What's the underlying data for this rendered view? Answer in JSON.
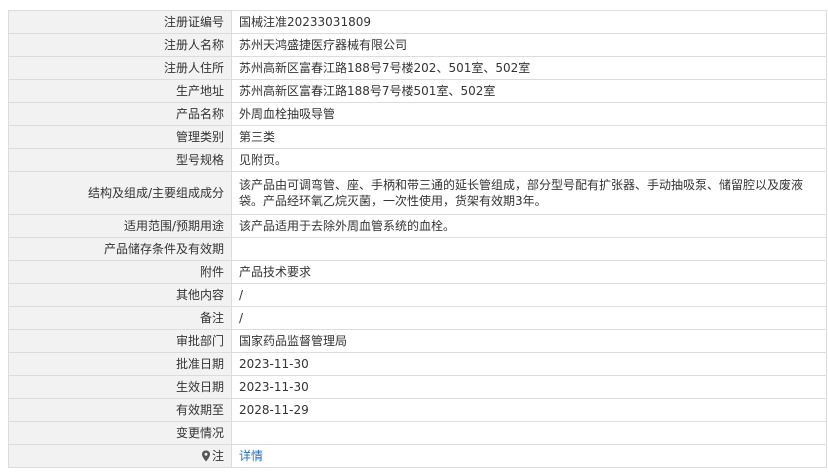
{
  "rows": [
    {
      "label": "注册证编号",
      "value": "国械注准20233031809"
    },
    {
      "label": "注册人名称",
      "value": "苏州天鸿盛捷医疗器械有限公司"
    },
    {
      "label": "注册人住所",
      "value": "苏州高新区富春江路188号7号楼202、501室、502室"
    },
    {
      "label": "生产地址",
      "value": "苏州高新区富春江路188号7号楼501室、502室"
    },
    {
      "label": "产品名称",
      "value": "外周血栓抽吸导管"
    },
    {
      "label": "管理类别",
      "value": "第三类"
    },
    {
      "label": "型号规格",
      "value": "见附页。"
    },
    {
      "label": "结构及组成/主要组成成分",
      "value": "该产品由可调弯管、座、手柄和带三通的延长管组成，部分型号配有扩张器、手动抽吸泵、储留腔以及废液袋。产品经环氧乙烷灭菌，一次性使用，货架有效期3年。"
    },
    {
      "label": "适用范围/预期用途",
      "value": "该产品适用于去除外周血管系统的血栓。"
    },
    {
      "label": "产品储存条件及有效期",
      "value": ""
    },
    {
      "label": "附件",
      "value": "产品技术要求"
    },
    {
      "label": "其他内容",
      "value": "/"
    },
    {
      "label": "备注",
      "value": "/"
    },
    {
      "label": "审批部门",
      "value": "国家药品监督管理局"
    },
    {
      "label": "批准日期",
      "value": "2023-11-30"
    },
    {
      "label": "生效日期",
      "value": "2023-11-30"
    },
    {
      "label": "有效期至",
      "value": "2028-11-29"
    },
    {
      "label": "变更情况",
      "value": ""
    }
  ],
  "note": {
    "label": "注",
    "icon": "pin-icon",
    "link_text": "详情",
    "link_color": "#2a6ebb"
  }
}
